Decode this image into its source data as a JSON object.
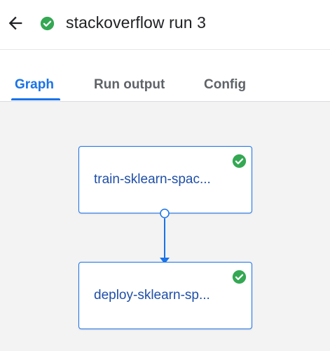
{
  "header": {
    "back_icon": "arrow-back-icon",
    "status_icon": "check-circle-icon",
    "status_color": "#34a853",
    "title": "stackoverflow run 3"
  },
  "tabs": [
    {
      "label": "Graph",
      "active": true
    },
    {
      "label": "Run output",
      "active": false
    },
    {
      "label": "Config",
      "active": false
    }
  ],
  "accent_color": "#1a73e8",
  "graph": {
    "nodes": [
      {
        "label": "train-sklearn-spac...",
        "status_icon": "check-circle-icon"
      },
      {
        "label": "deploy-sklearn-sp...",
        "status_icon": "check-circle-icon"
      }
    ]
  }
}
